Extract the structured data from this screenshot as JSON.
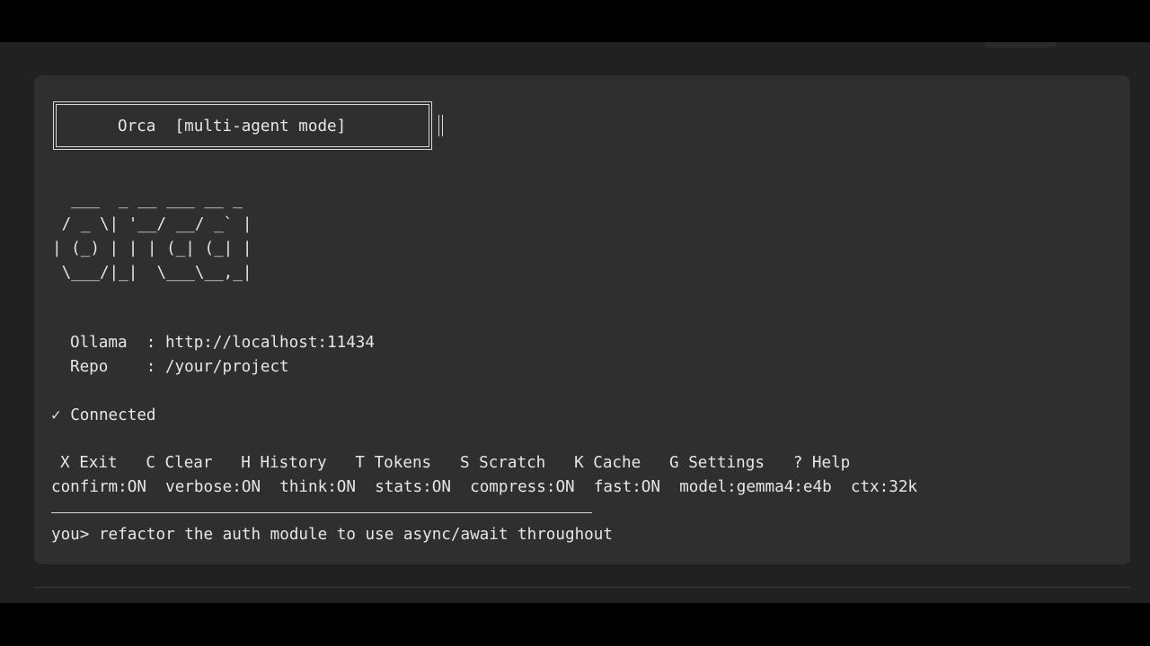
{
  "banner": {
    "title": "Orca  [multi-agent mode]"
  },
  "ascii_logo": {
    "lines": [
      "  ___  _ __ ___ __ _ ",
      " / _ \\| '__/ __/ _` |",
      "| (_) | | | (_| (_| |",
      " \\___/|_|  \\___\\__,_|"
    ]
  },
  "info": {
    "ollama_label": "Ollama",
    "ollama_sep": ":",
    "ollama_value": "http://localhost:11434",
    "repo_label": "Repo",
    "repo_sep": ":",
    "repo_value": "/your/project"
  },
  "status": {
    "icon": "check-icon",
    "text": "Connected"
  },
  "shortcuts": [
    {
      "key": "X",
      "label": "Exit"
    },
    {
      "key": "C",
      "label": "Clear"
    },
    {
      "key": "H",
      "label": "History"
    },
    {
      "key": "T",
      "label": "Tokens"
    },
    {
      "key": "S",
      "label": "Scratch"
    },
    {
      "key": "K",
      "label": "Cache"
    },
    {
      "key": "G",
      "label": "Settings"
    },
    {
      "key": "?",
      "label": "Help"
    }
  ],
  "toggles": [
    "confirm:ON",
    "verbose:ON",
    "think:ON",
    "stats:ON",
    "compress:ON",
    "fast:ON",
    "model:gemma4:e4b",
    "ctx:32k"
  ],
  "prompt": {
    "prefix": "you>",
    "text": "refactor the auth module to use async/await throughout"
  },
  "colors": {
    "panel": "#2f2f2f",
    "background": "#212121",
    "text": "#e6e6e6"
  }
}
